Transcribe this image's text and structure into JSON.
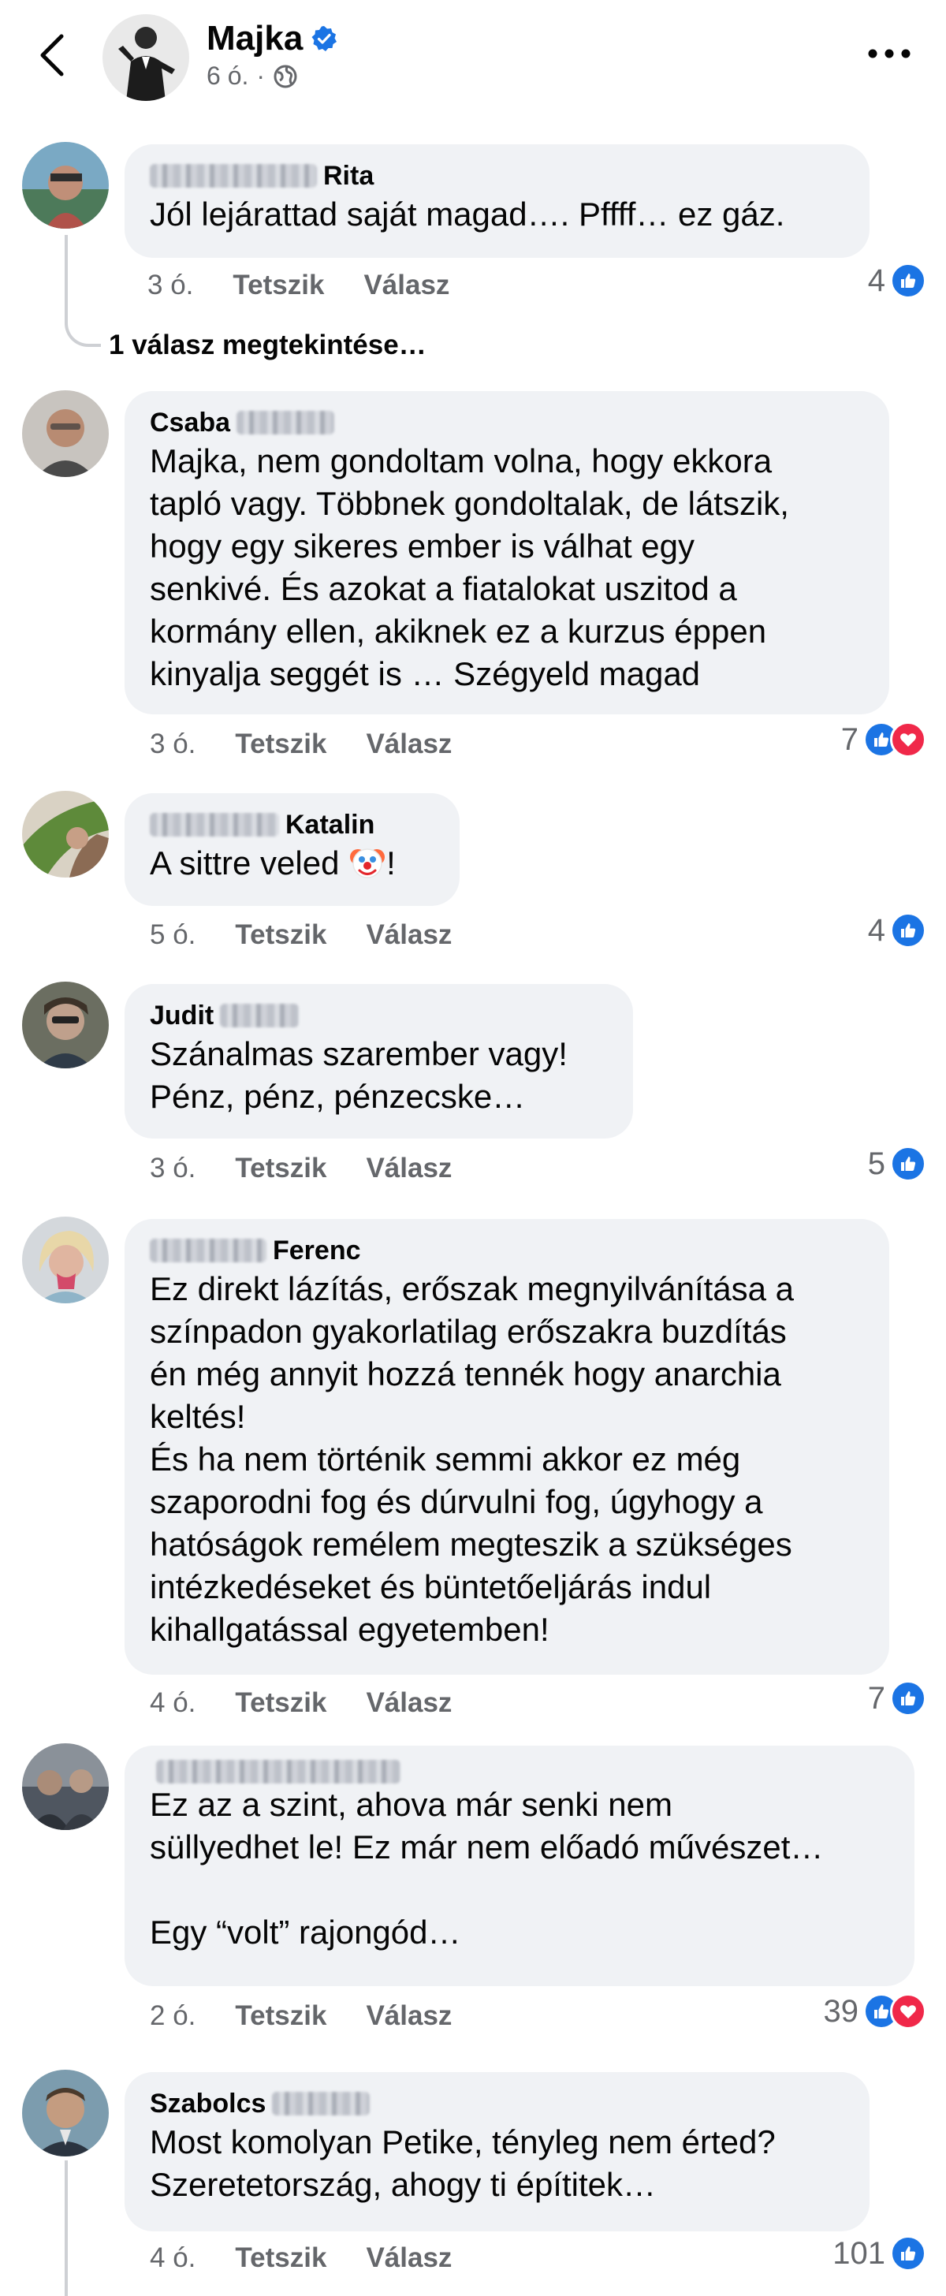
{
  "header": {
    "title": "Majka",
    "time": "6 ó.",
    "separator": "·",
    "accent": "#1b74e4"
  },
  "comments": [
    {
      "author_visible": "Rita",
      "text": "Jól lejárattad saját magad…. Pffff… ez gáz.",
      "age": "3 ó.",
      "like_label": "Tetszik",
      "reply_label": "Válasz",
      "reaction_count": "4",
      "reactions": [
        "like"
      ]
    },
    {
      "author_visible": "Csaba",
      "text": "Majka, nem gondoltam volna, hogy ekkora\ntapló vagy. Többnek gondoltalak, de látszik,\nhogy egy sikeres ember is válhat egy\nsenkivé. És azokat a fiatalokat uszitod a\nkormány ellen, akiknek ez a kurzus éppen\nkinyalja seggét is … Szégyeld magad",
      "age": "3 ó.",
      "like_label": "Tetszik",
      "reply_label": "Válasz",
      "reaction_count": "7",
      "reactions": [
        "like",
        "love"
      ]
    },
    {
      "author_visible": "Katalin",
      "text": "A sittre veled",
      "text_suffix": "!",
      "age": "5 ó.",
      "like_label": "Tetszik",
      "reply_label": "Válasz",
      "reaction_count": "4",
      "reactions": [
        "like"
      ]
    },
    {
      "author_visible": "Judit",
      "text": "Szánalmas szarember vagy!\nPénz, pénz, pénzecske…",
      "age": "3 ó.",
      "like_label": "Tetszik",
      "reply_label": "Válasz",
      "reaction_count": "5",
      "reactions": [
        "like"
      ]
    },
    {
      "author_visible": "Ferenc",
      "text": "Ez direkt lázítás, erőszak megnyilvánítása a\nszínpadon gyakorlatilag erőszakra buzdítás\nén még annyit hozzá tennék hogy anarchia\nkeltés!\nÉs ha nem történik semmi akkor ez még\nszaporodni fog és dúrvulni fog, úgyhogy a\nhatóságok remélem megteszik a szükséges\nintézkedéseket és büntetőeljárás indul\nkihallgatással egyetemben!",
      "age": "4 ó.",
      "like_label": "Tetszik",
      "reply_label": "Válasz",
      "reaction_count": "7",
      "reactions": [
        "like"
      ]
    },
    {
      "author_visible": "",
      "text": "Ez az a szint, ahova már senki nem\nsüllyedhet le! Ez már nem előadó művészet…\n\nEgy “volt” rajongód…",
      "age": "2 ó.",
      "like_label": "Tetszik",
      "reply_label": "Válasz",
      "reaction_count": "39",
      "reactions": [
        "like",
        "love"
      ]
    },
    {
      "author_visible": "Szabolcs",
      "text": "Most komolyan Petike, tényleg nem érted?\nSzeretetország, ahogy ti építitek…",
      "age": "4 ó.",
      "like_label": "Tetszik",
      "reply_label": "Válasz",
      "reaction_count": "101",
      "reactions": [
        "like"
      ]
    }
  ],
  "view_replies": "1 válasz megtekintése…",
  "colors": {
    "bubble": "#f0f2f5",
    "meta": "#65676b",
    "like": "#1b74e4",
    "love": "#f02849"
  },
  "icons": {
    "back": "chevron-left-icon",
    "verified": "verified-badge-icon",
    "audience": "globe-icon",
    "more": "more-dots-icon",
    "clown": "clown-face-icon"
  }
}
